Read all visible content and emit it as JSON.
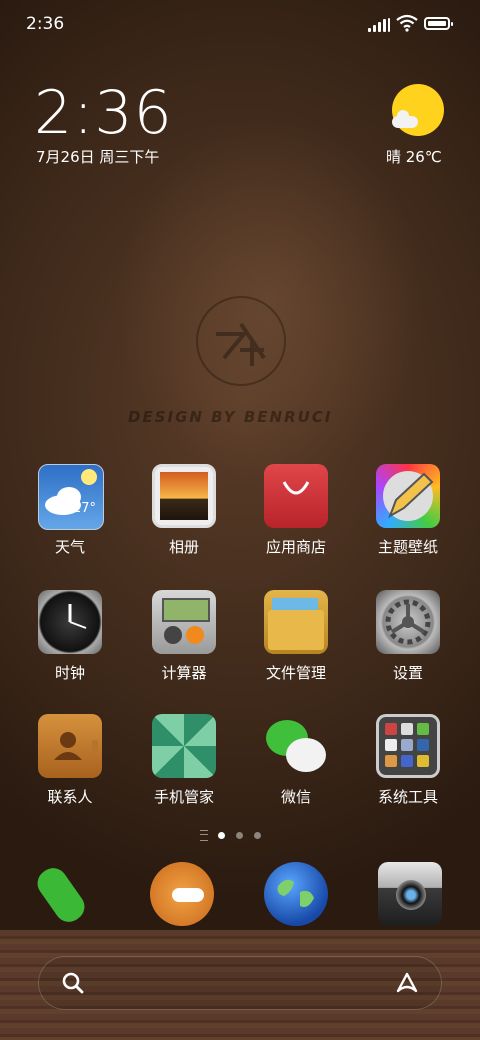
{
  "statusbar": {
    "time": "2:36"
  },
  "widget": {
    "clock": "2:36",
    "date": "7月26日 周三下午",
    "weather": "晴 26℃",
    "weather_icon": "sunny-cloud-icon"
  },
  "wallpaper": {
    "watermark": "DESIGN BY BENRUCI"
  },
  "apps": [
    {
      "label": "天气",
      "icon": "weather-icon",
      "badge": "27°"
    },
    {
      "label": "相册",
      "icon": "photos-icon"
    },
    {
      "label": "应用商店",
      "icon": "app-store-icon"
    },
    {
      "label": "主题壁纸",
      "icon": "themes-icon"
    },
    {
      "label": "时钟",
      "icon": "clock-icon"
    },
    {
      "label": "计算器",
      "icon": "calculator-icon"
    },
    {
      "label": "文件管理",
      "icon": "folder-icon"
    },
    {
      "label": "设置",
      "icon": "gear-icon"
    },
    {
      "label": "联系人",
      "icon": "contacts-icon"
    },
    {
      "label": "手机管家",
      "icon": "umbrella-icon"
    },
    {
      "label": "微信",
      "icon": "wechat-icon"
    },
    {
      "label": "系统工具",
      "icon": "tools-folder-icon"
    }
  ],
  "pager": {
    "pages": 3,
    "current": 1
  },
  "dock": [
    {
      "icon": "phone-icon"
    },
    {
      "icon": "messages-icon"
    },
    {
      "icon": "globe-icon"
    },
    {
      "icon": "camera-icon"
    }
  ],
  "colors": {
    "wallpaper": "#3a2618",
    "weather_sun": "#ffd21e",
    "wechat": "#3fbf3a"
  }
}
